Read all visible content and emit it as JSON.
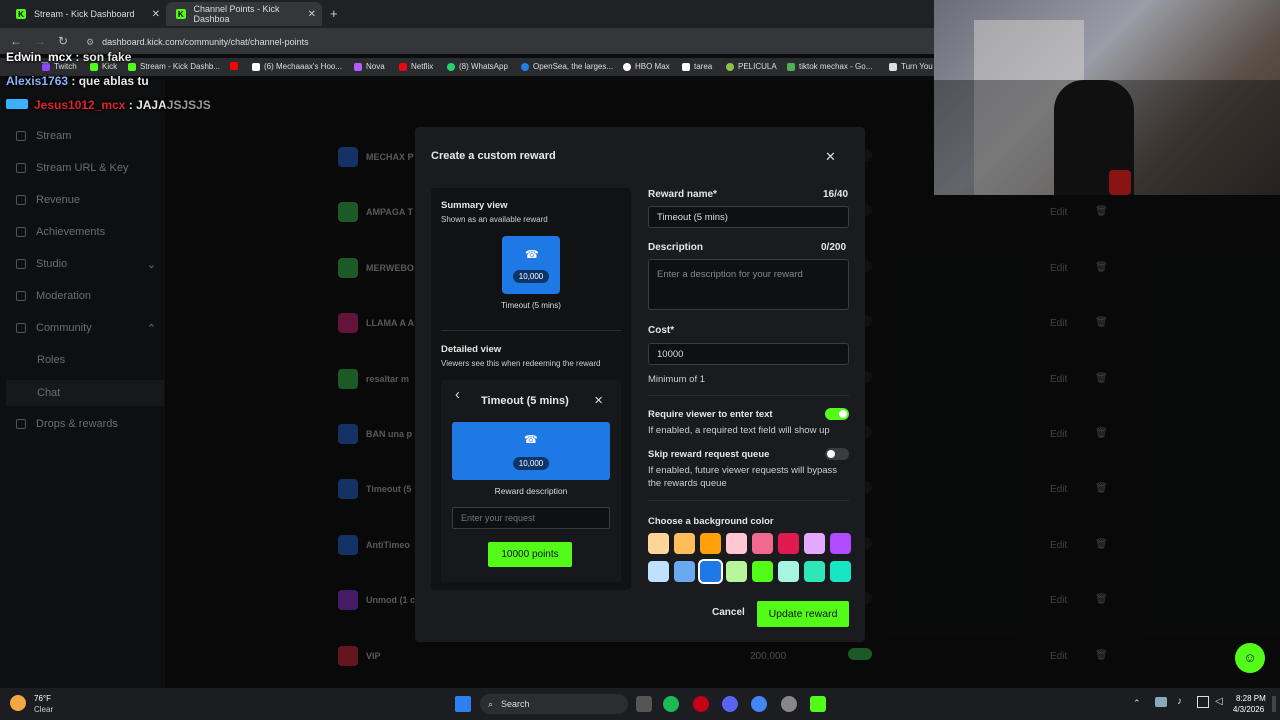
{
  "browser": {
    "tabs": [
      {
        "title": "Stream - Kick Dashboard",
        "close": "✕"
      },
      {
        "title": "Channel Points - Kick Dashboa",
        "close": "✕"
      }
    ],
    "new_tab": "+",
    "url": "dashboard.kick.com/community/chat/channel-points",
    "bookmarks": [
      "Twitch",
      "Kick",
      "Stream - Kick Dashb...",
      "(6) Mechaaax's Hoo...",
      "Nova",
      "Netflix",
      "(8) WhatsApp",
      "OpenSea, the larges...",
      "HBO Max",
      "tarea",
      "PELICULA",
      "tiktok mechax - Go...",
      "Turn You"
    ]
  },
  "chat_overlay": [
    {
      "user": "Edwin_mcx",
      "msg": " : son fake",
      "color": "#ffffff"
    },
    {
      "user": "Alexis1763",
      "msg": " : que ablas tu",
      "color": "#8ab4ff"
    },
    {
      "user": "Jesus1012_mcx",
      "msg": " : JAJAJSJSJS",
      "color": "#e0242b"
    }
  ],
  "sidebar": {
    "items": [
      {
        "label": "Stream"
      },
      {
        "label": "Stream URL & Key"
      },
      {
        "label": "Revenue"
      },
      {
        "label": "Achievements"
      },
      {
        "label": "Studio"
      },
      {
        "label": "Moderation"
      },
      {
        "label": "Community"
      }
    ],
    "sub_items": [
      "Roles",
      "Chat"
    ],
    "last_item": "Drops & rewards"
  },
  "rewards_list": [
    {
      "name": "MECHAX P",
      "color": "#1f4f9a"
    },
    {
      "name": "AMPAGA T",
      "color": "#2c8a3a"
    },
    {
      "name": "MERWEBO",
      "color": "#2c8a3a"
    },
    {
      "name": "LLAMA A A",
      "color": "#9a1f5a"
    },
    {
      "name": "resaltar m",
      "color": "#2c8a3a"
    },
    {
      "name": "BAN una p",
      "color": "#1f4f9a"
    },
    {
      "name": "Timeout (5",
      "color": "#1f4f9a"
    },
    {
      "name": "AntiTimeo",
      "color": "#1f4f9a"
    },
    {
      "name": "Unmod (1 c",
      "color": "#6a2c9a"
    },
    {
      "name": "VIP",
      "color": "#9a1f2c",
      "cost": "200,000"
    }
  ],
  "rewards_edit_label": "Edit",
  "rewards_delete_icon": "🗑",
  "modal": {
    "title": "Create a custom reward",
    "close": "✕",
    "summary": {
      "heading": "Summary view",
      "sub": "Shown as an available reward",
      "card_cost": "10,000",
      "card_name": "Timeout (5 mins)"
    },
    "detailed": {
      "heading": "Detailed view",
      "sub": "Viewers see this when redeeming the reward",
      "back": "‹",
      "title": "Timeout (5 mins)",
      "close": "✕",
      "card_cost": "10,000",
      "description": "Reward description",
      "request_placeholder": "Enter your request",
      "button": "10000 points"
    },
    "form": {
      "name_label": "Reward name*",
      "name_count": "16/40",
      "name_value": "Timeout (5 mins)",
      "desc_label": "Description",
      "desc_count": "0/200",
      "desc_placeholder": "Enter a description for your reward",
      "cost_label": "Cost*",
      "cost_value": "10000",
      "cost_min": "Minimum of 1",
      "require_label": "Require viewer to enter text",
      "require_help": "If enabled, a required text field will show up",
      "require_on": true,
      "skip_label": "Skip reward request queue",
      "skip_help_1": "If enabled, future viewer requests will bypass",
      "skip_help_2": "the rewards queue",
      "skip_on": false,
      "color_label": "Choose a background color",
      "colors": [
        "#ffd59a",
        "#ffbe5c",
        "#ff9f0a",
        "#ffc7d3",
        "#ef6a8c",
        "#e01a4f",
        "#e3a8ff",
        "#b04bff",
        "#bfe1ff",
        "#6aa8f0",
        "#1e78e6",
        "#b8f59a",
        "#53fc18",
        "#a6f5e3",
        "#2ee6b8",
        "#17e6c4"
      ],
      "selected_color": "#1e78e6",
      "cancel": "Cancel",
      "submit": "Update reward"
    }
  },
  "taskbar": {
    "weather_temp": "76°F",
    "weather_desc": "Clear",
    "search": "Search",
    "time": "8:28 PM",
    "date": "4/3/2026"
  }
}
